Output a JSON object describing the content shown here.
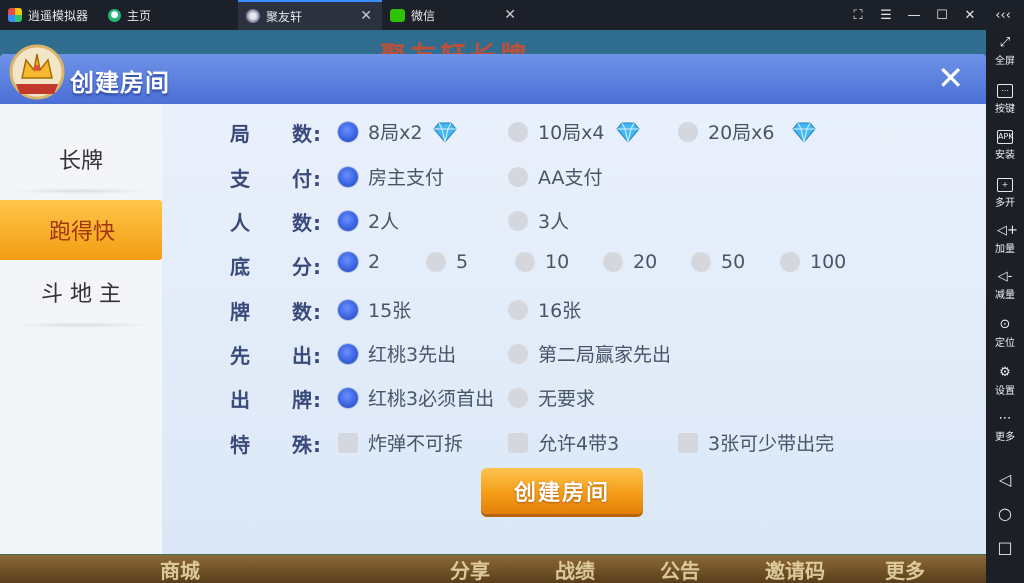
{
  "tabs": [
    {
      "label": "逍遥模拟器"
    },
    {
      "label": "主页"
    },
    {
      "label": "聚友轩",
      "active": true
    },
    {
      "label": "微信"
    }
  ],
  "window_controls": [
    "fullscreen-icon",
    "menu-icon",
    "minimize-icon",
    "maximize-icon",
    "close-icon",
    "collapse-icon"
  ],
  "emulator_sidebar": [
    {
      "label": "全屏",
      "icon": "fullscreen-icon"
    },
    {
      "label": "按键",
      "icon": "keyboard-icon"
    },
    {
      "label": "安装",
      "icon": "apk-icon",
      "icon_text": "APK"
    },
    {
      "label": "多开",
      "icon": "multi-open-icon"
    },
    {
      "label": "加量",
      "icon": "volume-up-icon"
    },
    {
      "label": "减量",
      "icon": "volume-down-icon"
    },
    {
      "label": "定位",
      "icon": "location-icon"
    },
    {
      "label": "设置",
      "icon": "settings-icon"
    },
    {
      "label": "更多",
      "icon": "more-icon"
    }
  ],
  "dialog": {
    "title": "创建房间",
    "close_icon": "close-icon",
    "game_types": [
      {
        "label": "长牌",
        "active": false
      },
      {
        "label": "跑得快",
        "active": true
      },
      {
        "label": "斗 地 主",
        "active": false
      }
    ],
    "rows": [
      {
        "label_a": "局",
        "label_b": "数:",
        "type": "radio",
        "options": [
          {
            "text": "8局x2",
            "selected": true,
            "gem": true
          },
          {
            "text": "10局x4",
            "selected": false,
            "gem": true
          },
          {
            "text": "20局x6",
            "selected": false,
            "gem": true
          }
        ]
      },
      {
        "label_a": "支",
        "label_b": "付:",
        "type": "radio",
        "options": [
          {
            "text": "房主支付",
            "selected": true
          },
          {
            "text": "AA支付",
            "selected": false
          }
        ]
      },
      {
        "label_a": "人",
        "label_b": "数:",
        "type": "radio",
        "options": [
          {
            "text": "2人",
            "selected": true
          },
          {
            "text": "3人",
            "selected": false
          }
        ]
      },
      {
        "label_a": "底",
        "label_b": "分:",
        "type": "radio",
        "options": [
          {
            "text": "2",
            "selected": true
          },
          {
            "text": "5",
            "selected": false
          },
          {
            "text": "10",
            "selected": false
          },
          {
            "text": "20",
            "selected": false
          },
          {
            "text": "50",
            "selected": false
          },
          {
            "text": "100",
            "selected": false
          }
        ]
      },
      {
        "label_a": "牌",
        "label_b": "数:",
        "type": "radio",
        "options": [
          {
            "text": "15张",
            "selected": true
          },
          {
            "text": "16张",
            "selected": false
          }
        ]
      },
      {
        "label_a": "先",
        "label_b": "出:",
        "type": "radio",
        "options": [
          {
            "text": "红桃3先出",
            "selected": true
          },
          {
            "text": "第二局赢家先出",
            "selected": false
          }
        ]
      },
      {
        "label_a": "出",
        "label_b": "牌:",
        "type": "radio",
        "options": [
          {
            "text": "红桃3必须首出",
            "selected": true
          },
          {
            "text": "无要求",
            "selected": false
          }
        ]
      },
      {
        "label_a": "特",
        "label_b": "殊:",
        "type": "checkbox",
        "options": [
          {
            "text": "炸弹不可拆",
            "selected": false
          },
          {
            "text": "允许4带3",
            "selected": false
          },
          {
            "text": "3张可少带出完",
            "selected": false
          }
        ]
      }
    ],
    "create_button": "创建房间"
  },
  "colors": {
    "header_blue": "#5a7fe0",
    "selected_radio": "#3b64e0",
    "button_orange": "#f39a14",
    "active_tab": "#f5a623"
  }
}
